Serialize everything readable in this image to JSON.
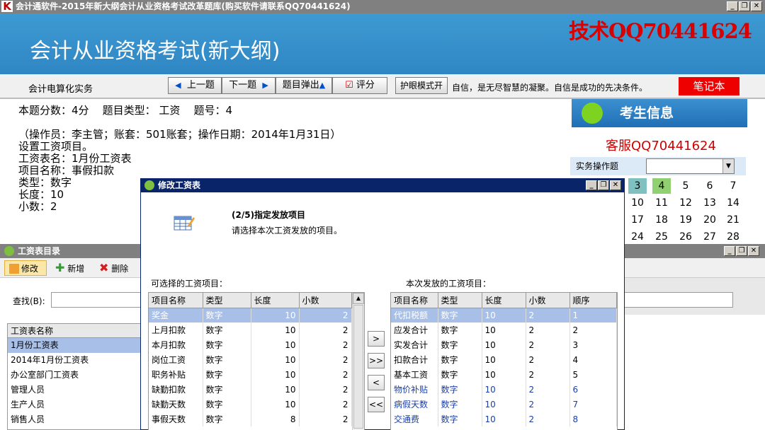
{
  "window": {
    "title": "会计通软件-2015年新大纲会计从业资格考试改革题库(购买软件请联系QQ70441624)",
    "logo": "K",
    "min": "_",
    "restore": "❐",
    "close": "✕"
  },
  "banner": {
    "title": "会计从业资格考试(新大纲)",
    "qq": "技术QQ70441624"
  },
  "toolbar": {
    "subject": "会计电算化实务",
    "prev": "上一题",
    "next": "下一题",
    "popup": "题目弹出",
    "score": "评分",
    "eyecare": "护眼模式开",
    "motto": "自信，是无尽智慧的凝聚。自信是成功的先决条件。",
    "notebook": "笔记本"
  },
  "question": {
    "line1": "本题分数：4分    题目类型： 工资    题号：4",
    "lines": [
      "（操作员：李主管；账套：501账套；操作日期：2014年1月31日）",
      "设置工资项目。",
      "工资表名：1月份工资表",
      "项目名称：事假扣款",
      "类型：数字",
      "长度：10",
      "小数：2"
    ]
  },
  "right_panel": {
    "header": "考生信息",
    "service": "客服QQ70441624",
    "practice_label": "实务操作题",
    "numbers": [
      "3",
      "4",
      "5",
      "6",
      "7",
      "10",
      "11",
      "12",
      "13",
      "14",
      "17",
      "18",
      "19",
      "20",
      "21",
      "24",
      "25",
      "26",
      "27",
      "28"
    ]
  },
  "left_window": {
    "title": "工资表目录",
    "edit": "修改",
    "add": "新增",
    "delete": "删除",
    "search_label": "查找(B):",
    "list_header": "工资表名称",
    "items": [
      "1月份工资表",
      "2014年1月份工资表",
      "办公室部门工资表",
      "管理人员",
      "生产人员",
      "销售人员"
    ]
  },
  "dialog": {
    "title": "修改工资表",
    "step": "(2/5)指定发放项目",
    "step_desc": "请选择本次工资发放的项目。",
    "available_label": "可选择的工资项目：",
    "selected_label": "本次发放的工资项目：",
    "available_headers": [
      "项目名称",
      "类型",
      "长度",
      "小数"
    ],
    "available_rows": [
      [
        "奖金",
        "数字",
        "10",
        "2"
      ],
      [
        "上月扣款",
        "数字",
        "10",
        "2"
      ],
      [
        "本月扣款",
        "数字",
        "10",
        "2"
      ],
      [
        "岗位工资",
        "数字",
        "10",
        "2"
      ],
      [
        "职务补贴",
        "数字",
        "10",
        "2"
      ],
      [
        "缺勤扣款",
        "数字",
        "10",
        "2"
      ],
      [
        "缺勤天数",
        "数字",
        "10",
        "2"
      ],
      [
        "事假天数",
        "数字",
        "8",
        "2"
      ]
    ],
    "selected_headers": [
      "项目名称",
      "类型",
      "长度",
      "小数",
      "顺序"
    ],
    "selected_rows": [
      [
        "代扣税额",
        "数字",
        "10",
        "2",
        "1"
      ],
      [
        "应发合计",
        "数字",
        "10",
        "2",
        "2"
      ],
      [
        "实发合计",
        "数字",
        "10",
        "2",
        "3"
      ],
      [
        "扣款合计",
        "数字",
        "10",
        "2",
        "4"
      ],
      [
        "基本工资",
        "数字",
        "10",
        "2",
        "5"
      ],
      [
        "物价补贴",
        "数字",
        "10",
        "2",
        "6"
      ],
      [
        "病假天数",
        "数字",
        "10",
        "2",
        "7"
      ],
      [
        "交通费",
        "数字",
        "10",
        "2",
        "8"
      ]
    ],
    "move_one": ">",
    "move_all": ">>",
    "back_one": "<",
    "back_all": "<<"
  }
}
